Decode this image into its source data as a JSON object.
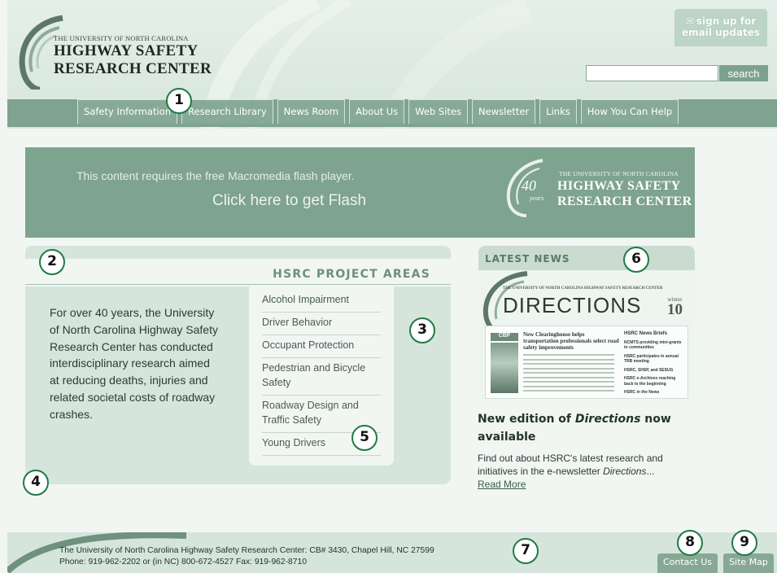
{
  "header": {
    "logo_small": "THE UNIVERSITY OF NORTH CAROLINA",
    "logo_line1": "HIGHWAY SAFETY",
    "logo_line2": "RESEARCH CENTER",
    "signup_line1": "sign up for",
    "signup_line2": "email updates",
    "search_value": "",
    "search_button": "search"
  },
  "nav": {
    "items": [
      "Safety Information",
      "Research Library",
      "News Room",
      "About Us",
      "Web Sites",
      "Newsletter",
      "Links",
      "How You Can Help"
    ]
  },
  "banner": {
    "message": "This content requires the free Macromedia flash player.",
    "link": "Click here to get Flash",
    "logo_number": "40",
    "logo_years": "years",
    "logo_small": "THE UNIVERSITY OF NORTH CAROLINA",
    "logo_line1": "HIGHWAY SAFETY",
    "logo_line2": "RESEARCH CENTER"
  },
  "projects": {
    "title": "HSRC PROJECT AREAS",
    "intro": "For over 40 years, the University of North Carolina Highway Safety Research Center has conducted interdisciplinary research aimed at reducing deaths, injuries and related societal costs of roadway crashes.",
    "areas": [
      "Alcohol Impairment",
      "Driver Behavior",
      "Occupant Protection",
      "Pedestrian and Bicycle Safety",
      "Roadway Design and Traffic Safety",
      "Young Drivers"
    ]
  },
  "news": {
    "title": "LATEST NEWS",
    "newsletter_small": "THE UNIVERSITY OF NORTH CAROLINA HIGHWAY SAFETY RESEARCH CENTER",
    "newsletter_name": "DIRECTIONS",
    "newsletter_season": "winter",
    "newsletter_issue": "10",
    "thumb_tag": "CBF",
    "thumb_headline": "New Clearinghouse helps transportation professionals select road safety improvements",
    "briefs_title": "HSRC News Briefs",
    "briefs": [
      "NCMTS providing mini-grants to communities",
      "HSRC participates in annual TRB meeting",
      "HSRC, SHSP, and SESUG",
      "HSRC e-Archives reaching back to the beginning",
      "HSRC in the News"
    ],
    "headline_pre": "New edition of ",
    "headline_em": "Directions",
    "headline_post": " now available",
    "text_pre": "Find out about HSRC's latest research and initiatives in the e-newsletter ",
    "text_em": "Directions",
    "text_post": "...",
    "read_more": "Read More"
  },
  "footer": {
    "line1": "The University of North Carolina Highway Safety Research Center: CB# 3430, Chapel Hill, NC 27599",
    "line2": "Phone: 919-962-2202 or (in NC) 800-672-4527 Fax: 919-962-8710",
    "contact": "Contact Us",
    "sitemap": "Site Map"
  },
  "markers": [
    "1",
    "2",
    "3",
    "4",
    "5",
    "6",
    "7",
    "8",
    "9"
  ]
}
